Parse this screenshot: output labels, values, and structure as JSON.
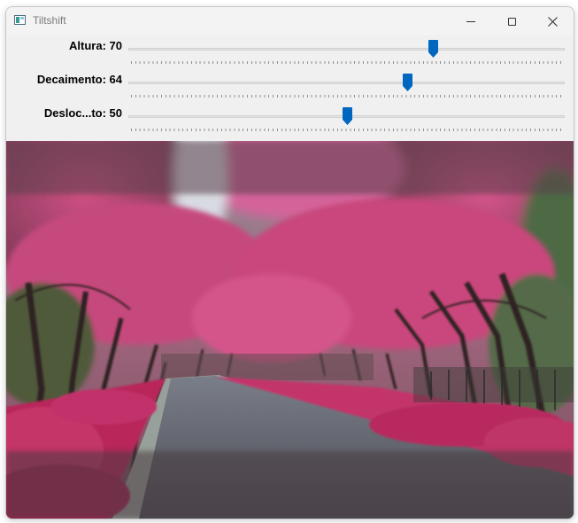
{
  "window": {
    "title": "Tiltshift",
    "icon": "app-window-icon",
    "buttons": [
      "minimize-icon",
      "maximize-icon",
      "close-icon"
    ]
  },
  "sliders": [
    {
      "label": "Altura: 70",
      "value": 70,
      "max": 100
    },
    {
      "label": "Decaimento: 64",
      "value": 64,
      "max": 100
    },
    {
      "label": "Desloc...to: 50",
      "value": 50,
      "max": 100
    }
  ],
  "colors": {
    "accent": "#0067c0",
    "blossom_pink": "#c9487a",
    "road_gray": "#585a63"
  },
  "image": {
    "subject": "pink-blossom tree tunnel over a road"
  }
}
